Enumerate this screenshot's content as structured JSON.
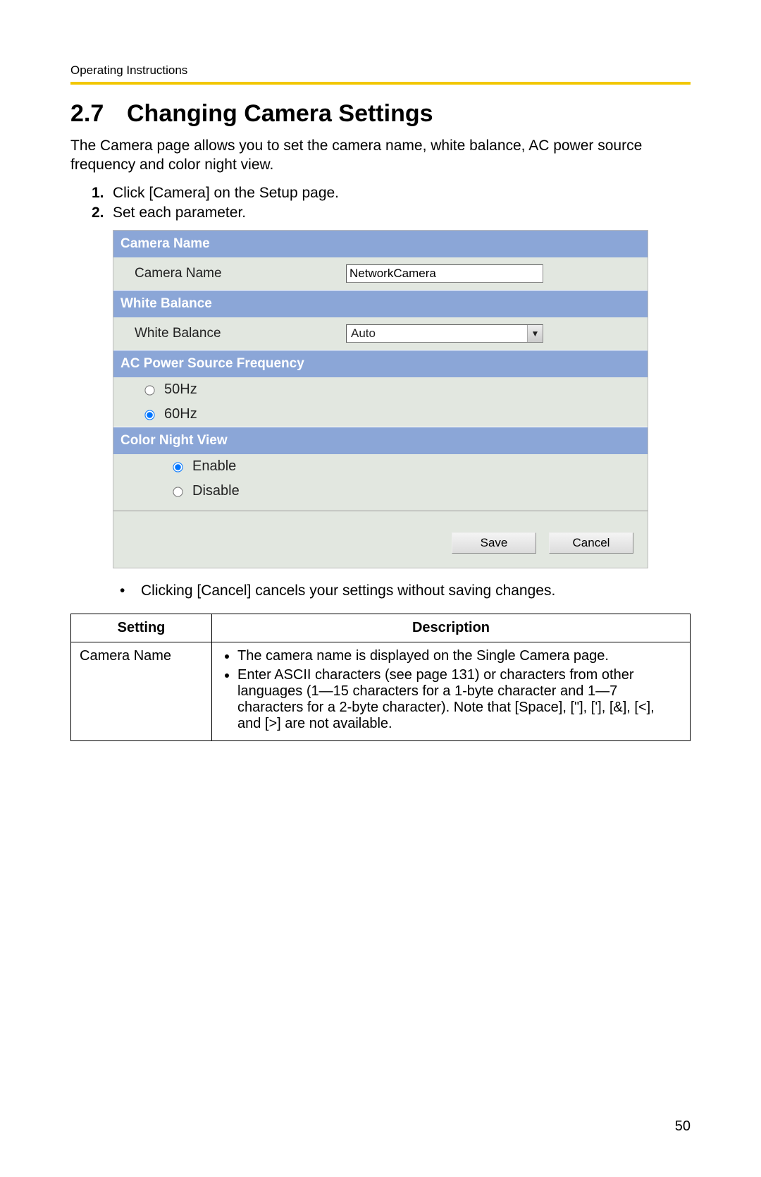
{
  "header": {
    "label": "Operating Instructions"
  },
  "section": {
    "number": "2.7",
    "title": "Changing Camera Settings",
    "intro": "The Camera page allows you to set the camera name, white balance, AC power source frequency and color night view."
  },
  "steps": [
    {
      "num": "1.",
      "text": "Click [Camera] on the Setup page."
    },
    {
      "num": "2.",
      "text": "Set each parameter."
    }
  ],
  "form": {
    "camera_name": {
      "bar": "Camera Name",
      "label": "Camera Name",
      "value": "NetworkCamera"
    },
    "white_balance": {
      "bar": "White Balance",
      "label": "White Balance",
      "value": "Auto"
    },
    "ac_power": {
      "bar": "AC Power Source Frequency",
      "options": [
        {
          "label": "50Hz",
          "checked": false
        },
        {
          "label": "60Hz",
          "checked": true
        }
      ]
    },
    "color_night": {
      "bar": "Color Night View",
      "options": [
        {
          "label": "Enable",
          "checked": true
        },
        {
          "label": "Disable",
          "checked": false
        }
      ]
    },
    "buttons": {
      "save": "Save",
      "cancel": "Cancel"
    }
  },
  "note": "Clicking [Cancel] cancels your settings without saving changes.",
  "table": {
    "headers": {
      "setting": "Setting",
      "description": "Description"
    },
    "rows": [
      {
        "setting": "Camera Name",
        "bullets": [
          "The camera name is displayed on the Single Camera page.",
          "Enter ASCII characters (see page 131) or characters from other languages (1—15 characters for a 1-byte character and 1—7 characters for a 2-byte character). Note that [Space], [\"], ['], [&], [<], and [>] are not available."
        ]
      }
    ]
  },
  "page_number": "50"
}
